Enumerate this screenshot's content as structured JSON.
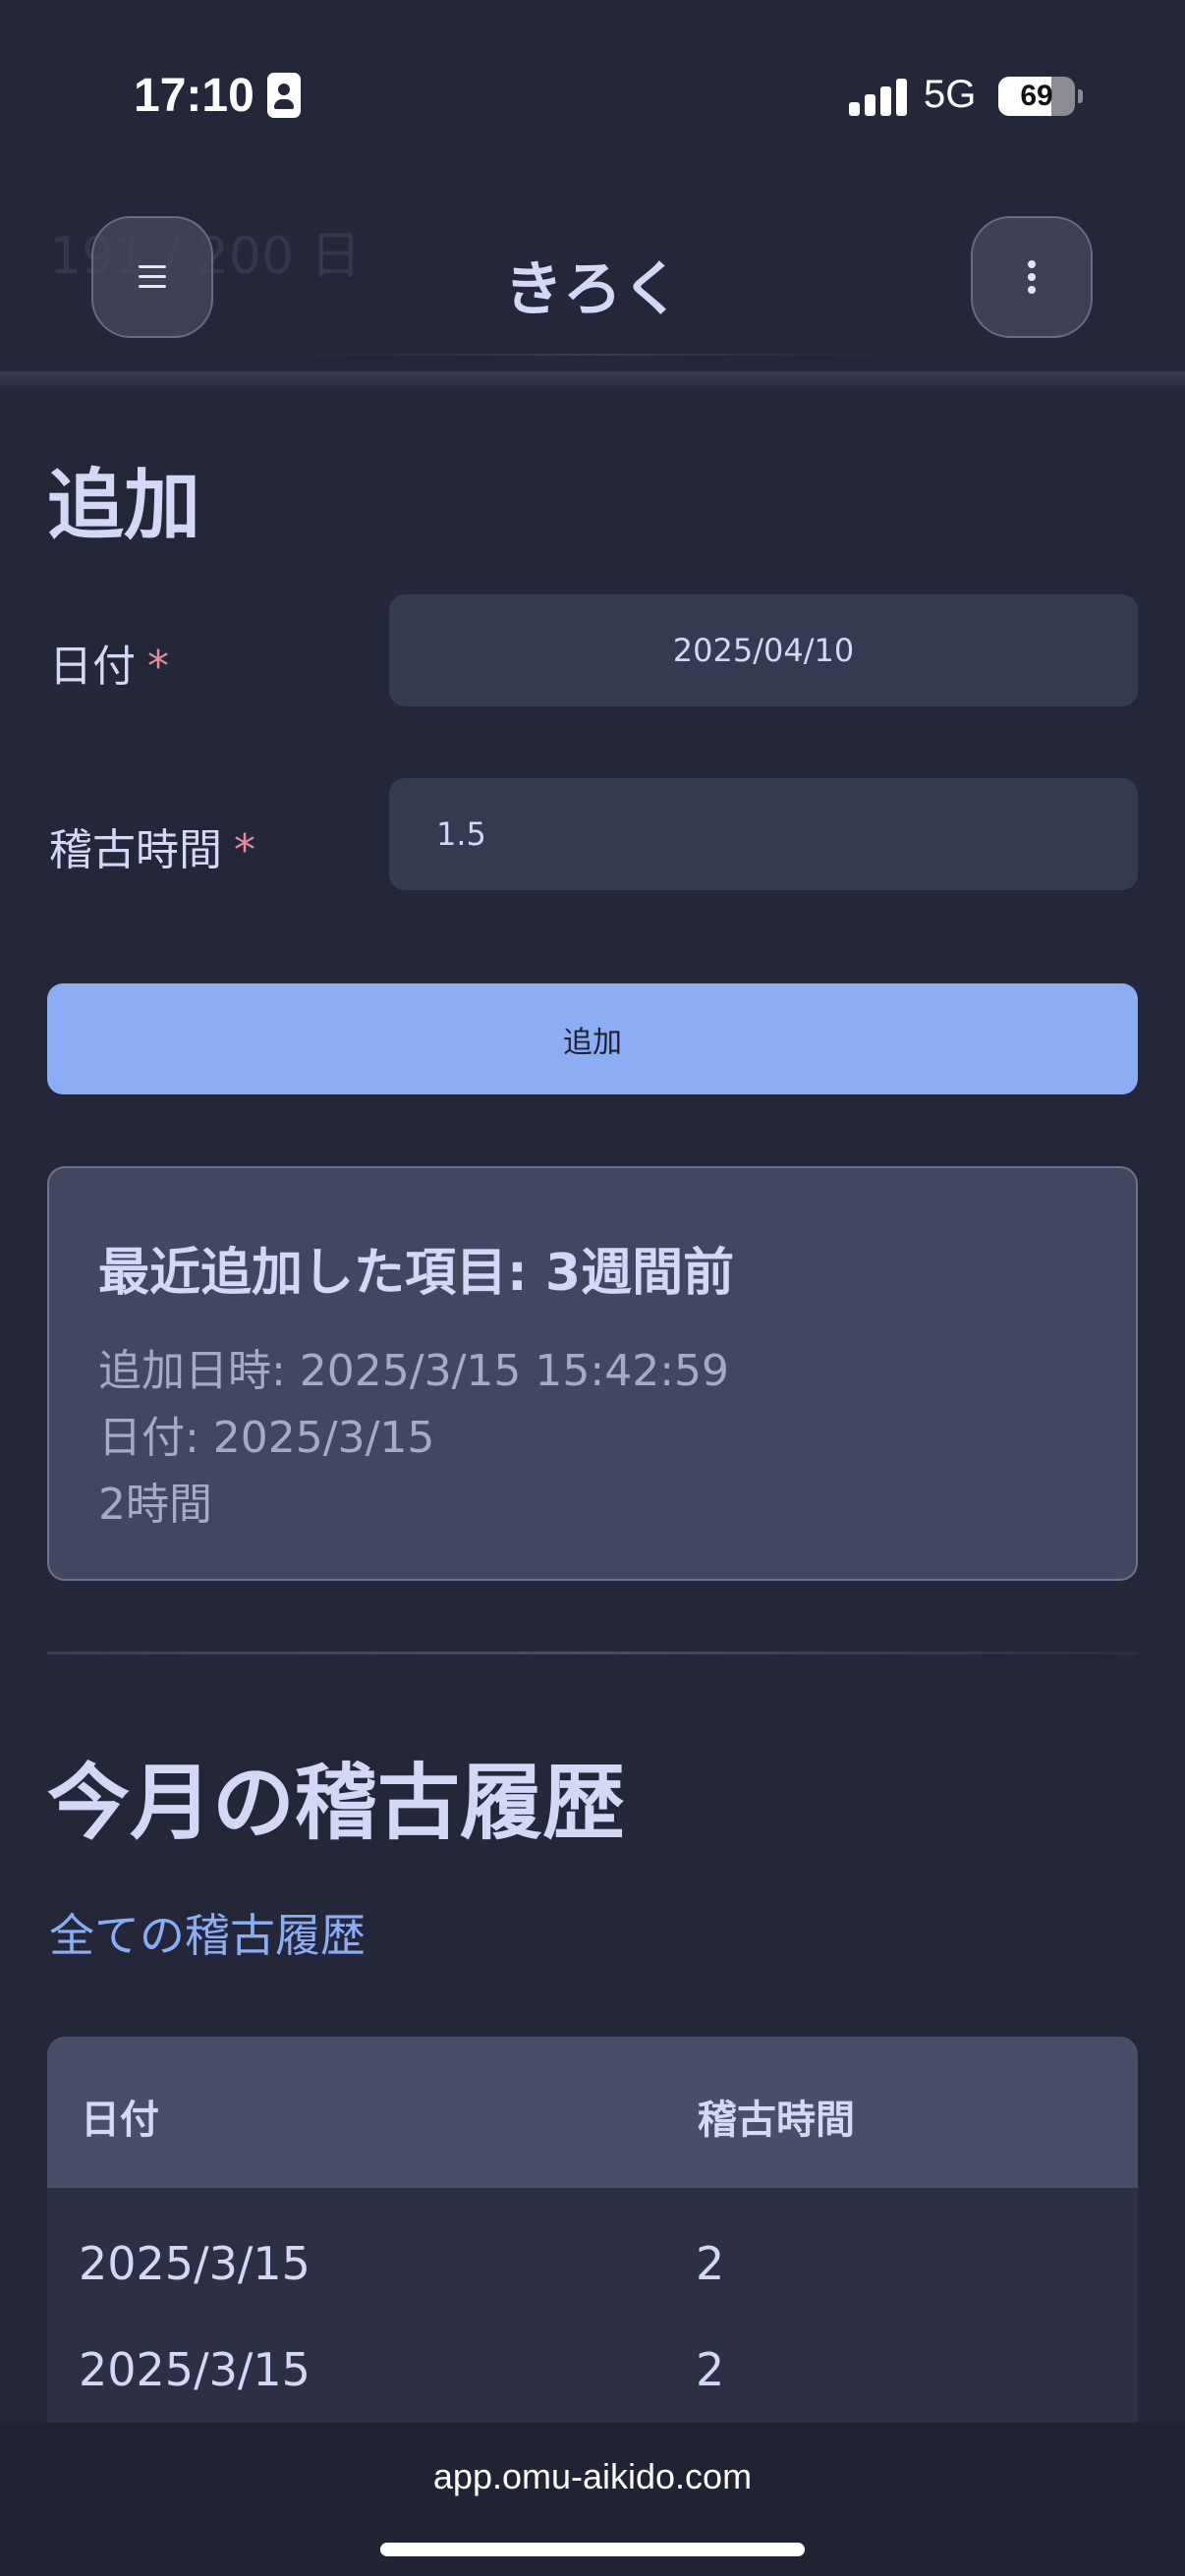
{
  "status_bar": {
    "time": "17:10",
    "network": "5G",
    "battery_percent": "69",
    "battery_level": 0.69,
    "icons": [
      "id-badge-icon",
      "signal-icon",
      "battery-icon"
    ]
  },
  "header": {
    "title": "きろく",
    "ghost_text": "191 / 200 日",
    "icons": [
      "hamburger-menu-icon",
      "kebab-menu-icon"
    ]
  },
  "add_form": {
    "title": "追加",
    "date_label": "日付",
    "hours_label": "稽古時間",
    "required_mark": "*",
    "date_value": "2025/04/10",
    "hours_value": "1.5",
    "submit_label": "追加"
  },
  "recent": {
    "title": "最近追加した項目: 3週間前",
    "added_at": "追加日時: 2025/3/15 15:42:59",
    "date": "日付: 2025/3/15",
    "hours": "2時間"
  },
  "history": {
    "title": "今月の稽古履歴",
    "all_link": "全ての稽古履歴",
    "columns": [
      "日付",
      "稽古時間"
    ],
    "rows": [
      [
        "2025/3/15",
        "2"
      ],
      [
        "2025/3/15",
        "2"
      ]
    ]
  },
  "browser": {
    "url": "app.omu-aikido.com"
  },
  "colors": {
    "background": "#24263a",
    "accent": "#8aadf4",
    "text": "#d4d7f6",
    "required": "#e48a9a"
  }
}
